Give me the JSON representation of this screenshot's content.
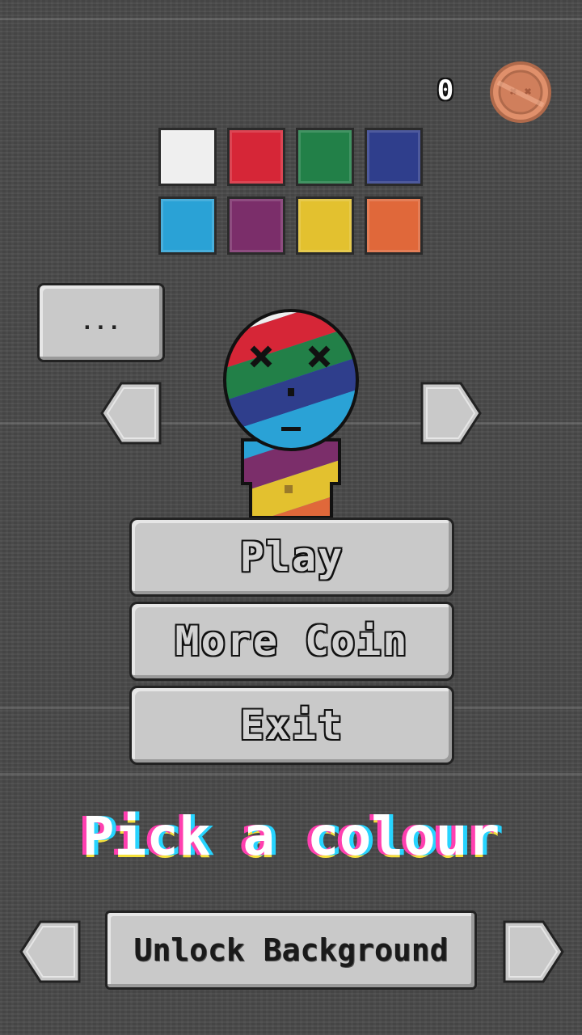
{
  "hud": {
    "coins": "0",
    "coin_icon": "coin-icon"
  },
  "colors": {
    "swatches": [
      "#efefef",
      "#d62637",
      "#228048",
      "#2f3e8c",
      "#2aa2d6",
      "#7b2e6a",
      "#e3c12f",
      "#e0683a"
    ]
  },
  "speech": {
    "label": "..."
  },
  "menu": {
    "play": "Play",
    "more_coin": "More Coin",
    "exit": "Exit"
  },
  "pick_colour": "Pick a colour",
  "background": {
    "unlock_label": "Unlock Background"
  },
  "icons": {
    "character_prev": "arrow-left-icon",
    "character_next": "arrow-right-icon",
    "bg_prev": "arrow-left-icon",
    "bg_next": "arrow-right-icon"
  }
}
